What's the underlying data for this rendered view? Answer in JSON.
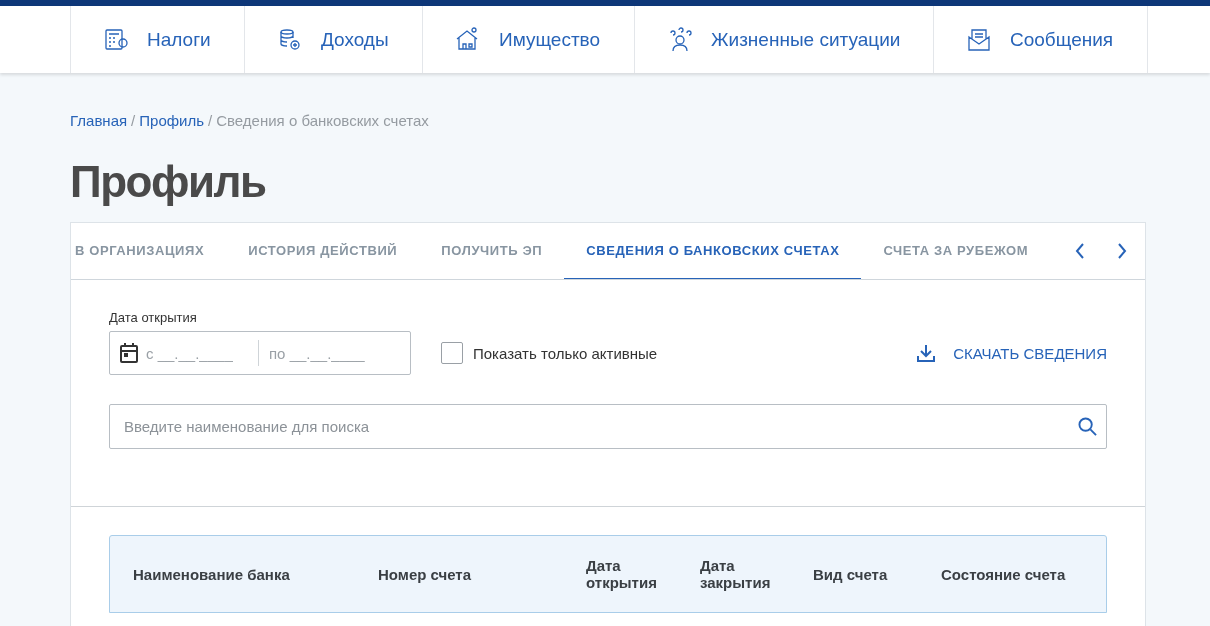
{
  "nav": [
    {
      "label": "Налоги"
    },
    {
      "label": "Доходы"
    },
    {
      "label": "Имущество"
    },
    {
      "label": "Жизненные ситуации"
    },
    {
      "label": "Сообщения"
    }
  ],
  "breadcrumbs": [
    {
      "label": "Главная",
      "link": true
    },
    {
      "separator": "/",
      "label": "Профиль",
      "link": true
    },
    {
      "separator": "/",
      "label": "Сведения о банковских счетах",
      "link": false
    }
  ],
  "page_title": "Профиль",
  "tabs": [
    {
      "label": "В ОРГАНИЗАЦИЯХ",
      "selected": false
    },
    {
      "label": "ИСТОРИЯ ДЕЙСТВИЙ",
      "selected": false
    },
    {
      "label": "ПОЛУЧИТЬ ЭП",
      "selected": false
    },
    {
      "label": "СВЕДЕНИЯ О БАНКОВСКИХ СЧЕТАХ",
      "selected": true
    },
    {
      "label": "СЧЕТА ЗА РУБЕЖОМ",
      "selected": false
    }
  ],
  "filters": {
    "date_label": "Дата открытия",
    "date_from": {
      "placeholder": "с __.__.____"
    },
    "date_to": {
      "placeholder": "по __.__.____"
    },
    "active_only": {
      "label": "Показать только активные",
      "checked": false
    },
    "download": "СКАЧАТЬ СВЕДЕНИЯ",
    "search": {
      "placeholder": "Введите наименование для поиска"
    }
  },
  "table": {
    "columns": [
      "Наименование банка",
      "Номер счета",
      "Дата открытия",
      "Дата закрытия",
      "Вид счета",
      "Состояние счета"
    ]
  }
}
